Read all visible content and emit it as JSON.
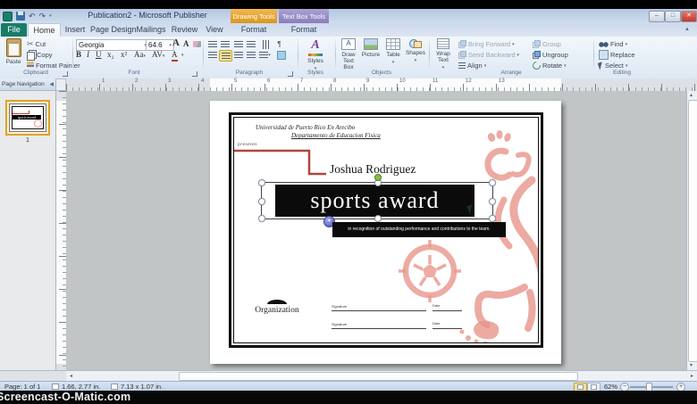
{
  "window": {
    "title": "Publication2 - Microsoft Publisher",
    "watermark": "Screencast-O-Matic.com",
    "contextual_groups": [
      {
        "label": "Drawing Tools",
        "color": "#d9961f"
      },
      {
        "label": "Text Box Tools",
        "color": "#8b7ebd"
      }
    ]
  },
  "tabs": [
    {
      "label": "File"
    },
    {
      "label": "Home"
    },
    {
      "label": "Insert"
    },
    {
      "label": "Page Design"
    },
    {
      "label": "Mailings"
    },
    {
      "label": "Review"
    },
    {
      "label": "View"
    },
    {
      "label": "Format"
    },
    {
      "label": "Format"
    }
  ],
  "ribbon": {
    "clipboard": {
      "group_label": "Clipboard",
      "paste": "Paste",
      "cut": "Cut",
      "copy": "Copy",
      "format_painter": "Format Painter"
    },
    "font": {
      "group_label": "Font",
      "family": "Georgia",
      "size": "64.6"
    },
    "paragraph": {
      "group_label": "Paragraph"
    },
    "styles": {
      "group_label": "Styles",
      "styles_button": "Styles"
    },
    "objects": {
      "group_label": "Objects",
      "draw_text_box": "Draw Text Box",
      "picture": "Picture",
      "table": "Table",
      "shapes": "Shapes"
    },
    "arrange": {
      "group_label": "Arrange",
      "wrap_text": "Wrap Text",
      "bring_forward": "Bring Forward",
      "send_backward": "Send Backward",
      "align": "Align",
      "group": "Group",
      "ungroup": "Ungroup",
      "rotate": "Rotate"
    },
    "editing": {
      "group_label": "Editing",
      "find": "Find",
      "replace": "Replace",
      "select": "Select"
    }
  },
  "ruler": {
    "h_numbers": [
      "1",
      "2",
      "3",
      "4",
      "5",
      "6",
      "7",
      "8",
      "9",
      "10",
      "11",
      "12",
      "13"
    ]
  },
  "page_navigation": {
    "header": "Page Navigation",
    "page_label": "1"
  },
  "certificate": {
    "university": "Universidad de Puerto Rico En Arecibo",
    "department": "Departamento de Educacion Fisica",
    "presents": "presents",
    "recipient": "Joshua Rodriguez",
    "award_title": "sports award",
    "recognition": "in recognition of outstanding performance and contributions to the team.",
    "organization": "Organization",
    "signature1_label": "Signature",
    "date1_label": "Date",
    "signature2_label": "Signature",
    "date2_label": "Date"
  },
  "status_bar": {
    "page_info": "Page: 1 of 1",
    "object_position": "1.66, 2.77 in.",
    "object_size": "7.13 x 1.07 in.",
    "zoom_level": "62%"
  },
  "colors": {
    "file_tab": "#187c68",
    "graphic_salmon": "#e8968c",
    "red_line": "#b5443a",
    "selection_highlight": "#fde28d"
  }
}
